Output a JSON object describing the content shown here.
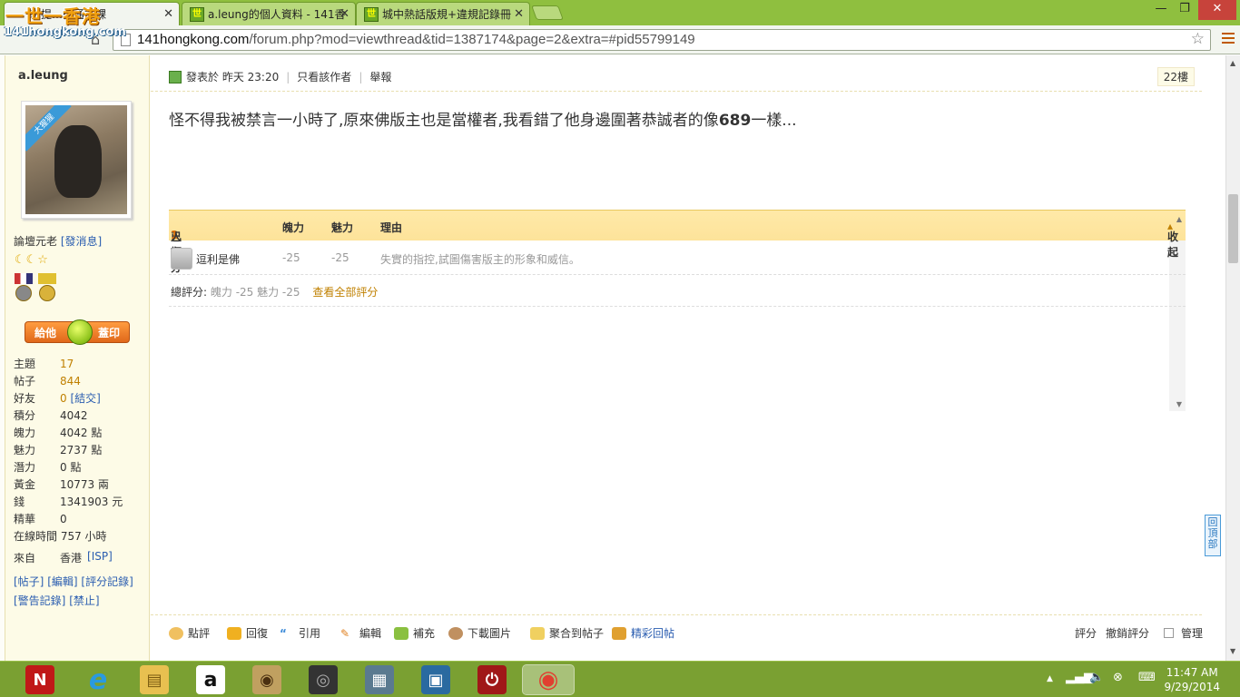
{
  "browser": {
    "logo": {
      "main": "一世一香港",
      "sub": "141hongkong.com"
    },
    "tabs": [
      {
        "title": "新提…的通識課",
        "active": true
      },
      {
        "title": "a.leung的個人資料 - 141香",
        "active": false
      },
      {
        "title": "城中熱話版規+違規記錄冊",
        "active": false
      }
    ],
    "tab_close_glyph": "✕",
    "window_controls": {
      "minimize": "—",
      "restore": "❐",
      "close": "✕"
    },
    "url_host": "141hongkong.com",
    "url_path": "/forum.php?mod=viewthread&tid=1387174&page=2&extra=#pid55799149"
  },
  "sidebar": {
    "username": "a.leung",
    "avatar_ribbon": "大猩猩",
    "rank": "論壇元老",
    "message_link": "[發消息]",
    "stamp_button": {
      "left": "給他",
      "right": "蓋印"
    },
    "stats": [
      {
        "label": "主題",
        "value": "17",
        "link": true
      },
      {
        "label": "帖子",
        "value": "844",
        "link": true
      },
      {
        "label": "好友",
        "value": "0",
        "extra": "[結交]",
        "link": true
      },
      {
        "label": "積分",
        "value": "4042"
      },
      {
        "label": "魄力",
        "value": "4042 點"
      },
      {
        "label": "魅力",
        "value": "2737 點"
      },
      {
        "label": "潛力",
        "value": "0 點"
      },
      {
        "label": "黃金",
        "value": "10773 兩"
      },
      {
        "label": "錢",
        "value": "1341903 元"
      },
      {
        "label": "精華",
        "value": "0"
      }
    ],
    "online_time": "在線時間 757 小時",
    "from_label": "來自",
    "from_value": "香港",
    "from_isp": "[ISP]",
    "links_row1": [
      "[帖子]",
      "[編輯]",
      "[評分記錄]"
    ],
    "links_row2": [
      "[警告記錄]",
      "[禁止]"
    ]
  },
  "post": {
    "posted_label": "發表於",
    "posted_time": "昨天 23:20",
    "only_author": "只看該作者",
    "report": "舉報",
    "floor": "22樓",
    "body_text": "怪不得我被禁言一小時了,原來佛版主也是當權者,我看錯了他身邊圍著恭誠者的像",
    "body_bold": "689",
    "body_tail": "一樣...",
    "rating": {
      "head_prefix": "已有",
      "head_count": "1",
      "head_suffix": "人評分",
      "col_power": "魄力",
      "col_charm": "魅力",
      "col_reason": "理由",
      "collapse": "收起",
      "rows": [
        {
          "user": "逗利是佛",
          "power": "-25",
          "charm": "-25",
          "reason": "失實的指控,試圖傷害版主的形象和威信。"
        }
      ],
      "total_label": "總評分:",
      "total_values": "魄力 -25  魅力 -25",
      "view_all": "查看全部評分"
    },
    "to_top": "回頂部",
    "actions": [
      {
        "label": "點評",
        "color": "#f0c060"
      },
      {
        "label": "回復",
        "color": "#f0b020"
      },
      {
        "label": "引用",
        "color": "#3a8ad8"
      },
      {
        "label": "編輯",
        "color": "#e08020"
      },
      {
        "label": "補充",
        "color": "#8ac040"
      },
      {
        "label": "下載圖片",
        "color": "#c09060"
      },
      {
        "label": "聚合到帖子",
        "color": "#f0d060"
      },
      {
        "label": "精彩回帖",
        "color": "#e0a030",
        "link": true
      }
    ],
    "right_actions": {
      "rate": "評分",
      "undo_rate": "撤銷評分",
      "manage": "管理"
    }
  },
  "taskbar": {
    "apps": [
      {
        "name": "netflix",
        "glyph": "N",
        "bg": "#c01818",
        "fg": "#fff"
      },
      {
        "name": "internet-explorer",
        "glyph": "e",
        "bg": "transparent",
        "fg": "#2a9ae0"
      },
      {
        "name": "file-explorer",
        "glyph": "▤",
        "bg": "#e8c050",
        "fg": "#7a5a10"
      },
      {
        "name": "amazon",
        "glyph": "a",
        "bg": "#fff",
        "fg": "#111"
      },
      {
        "name": "app-5",
        "glyph": "◉",
        "bg": "#c0a060",
        "fg": "#4a3010"
      },
      {
        "name": "app-6",
        "glyph": "◎",
        "bg": "#333",
        "fg": "#aaa"
      },
      {
        "name": "doc-app",
        "glyph": "▦",
        "bg": "#5a7a90",
        "fg": "#fff"
      },
      {
        "name": "app-8",
        "glyph": "▣",
        "bg": "#2a6aa0",
        "fg": "#fff"
      },
      {
        "name": "power-app",
        "glyph": "⏻",
        "bg": "#a01818",
        "fg": "#fff"
      },
      {
        "name": "chrome",
        "glyph": "◉",
        "bg": "transparent",
        "fg": "#e04030"
      }
    ],
    "time": "11:47 AM",
    "date": "9/29/2014"
  }
}
